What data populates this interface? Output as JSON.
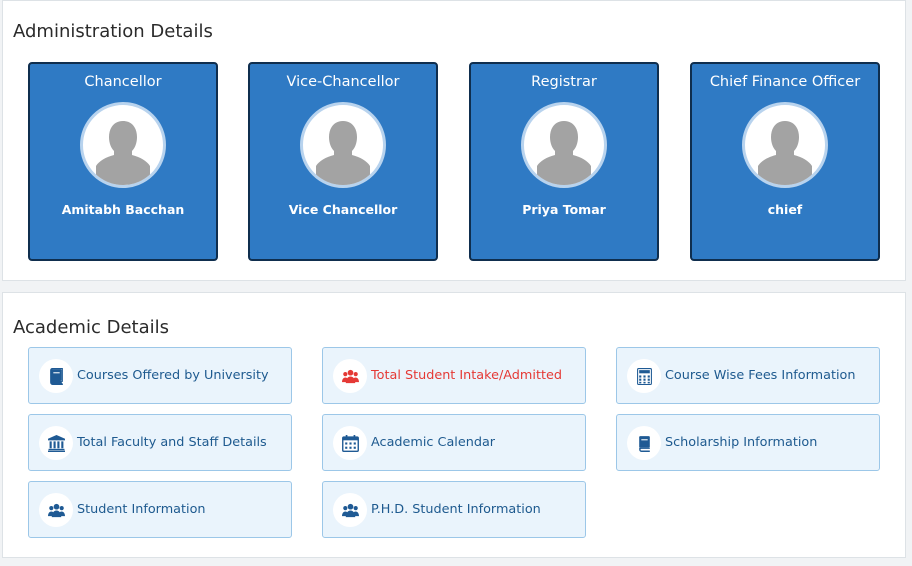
{
  "administration": {
    "title": "Administration Details",
    "cards": [
      {
        "role": "Chancellor",
        "name": "Amitabh Bacchan"
      },
      {
        "role": "Vice-Chancellor",
        "name": "Vice Chancellor"
      },
      {
        "role": "Registrar",
        "name": "Priya Tomar"
      },
      {
        "role": "Chief Finance Officer",
        "name": "chief"
      }
    ]
  },
  "academic": {
    "title": "Academic Details",
    "items": [
      {
        "label": "Courses Offered by University",
        "icon": "book-icon"
      },
      {
        "label": "Total Student Intake/Admitted",
        "icon": "users-icon",
        "color": "#e53935"
      },
      {
        "label": "Course Wise Fees Information",
        "icon": "calculator-icon"
      },
      {
        "label": "Total Faculty and Staff Details",
        "icon": "institution-icon"
      },
      {
        "label": "Academic Calendar",
        "icon": "calendar-icon"
      },
      {
        "label": "Scholarship Information",
        "icon": "book-icon"
      },
      {
        "label": "Student Information",
        "icon": "users-icon"
      },
      {
        "label": "P.H.D. Student Information",
        "icon": "users-icon"
      }
    ]
  },
  "colors": {
    "card_bg": "#2f7ac4",
    "tile_bg": "#eaf4fc",
    "tile_text": "#1e5a8f",
    "highlight_text": "#e53935"
  }
}
